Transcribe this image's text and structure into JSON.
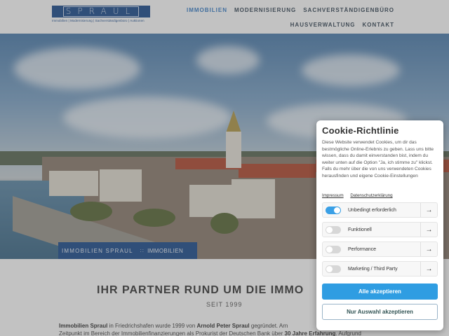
{
  "header": {
    "logo_text": "SPRAUL",
    "logo_subtitle": "Immobilien | Modernisierung | Sachverständigenbüro | Auktionen",
    "nav": [
      {
        "label": "IMMOBILIEN",
        "active": true
      },
      {
        "label": "MODERNISIERUNG",
        "active": false
      },
      {
        "label": "SACHVERSTÄNDIGENBÜRO",
        "active": false
      },
      {
        "label": "HAUSVERWALTUNG",
        "active": false
      },
      {
        "label": "KONTAKT",
        "active": false
      }
    ]
  },
  "breadcrumb": {
    "home": "IMMOBILIEN SPRAUL",
    "separator": "::",
    "current": "IMMOBILIEN"
  },
  "main": {
    "title": "IHR PARTNER RUND UM DIE IMMO",
    "subtitle": "SEIT 1999",
    "paragraph": {
      "company": "Immobilien Spraul",
      "text1": " in Friedrichshafen wurde 1999 von ",
      "founder": "Arnold Peter Spraul",
      "text2": " gegründet. Arn",
      "line2a": "Zeitpunkt im Bereich der Immobilienfinanzierungen als Prokurist der Deutschen Bank über ",
      "experience": "30 Jahre Erfahrung",
      "line2b": ". Aufgrund"
    }
  },
  "cookie": {
    "title": "Cookie-Richtlinie",
    "description": "Diese Website verwendet Cookies, um dir das bestmögliche Online-Erlebnis zu geben. Lass uns bitte wissen, dass du damit einverstanden bist, indem du weiter unten auf die Option \"Ja, ich stimme zu\" klickst. Falls du mehr über die von uns verwendeten Cookies herausfinden und eigene Cookie-Einstellungen",
    "link_imprint": "Impressum",
    "link_privacy": "Datenschutzerklärung",
    "options": [
      {
        "label": "Unbedingt erforderlich",
        "enabled": true
      },
      {
        "label": "Funktionell",
        "enabled": false
      },
      {
        "label": "Performance",
        "enabled": false
      },
      {
        "label": "Marketing / Third Party",
        "enabled": false
      }
    ],
    "accept_all": "Alle akzeptieren",
    "accept_selected": "Nur Auswahl akzeptieren"
  },
  "colors": {
    "brand_blue": "#1f4f8f",
    "nav_active": "#3a7fc8",
    "accept_button": "#2f9de2",
    "toggle_on": "#3aa0e6"
  }
}
